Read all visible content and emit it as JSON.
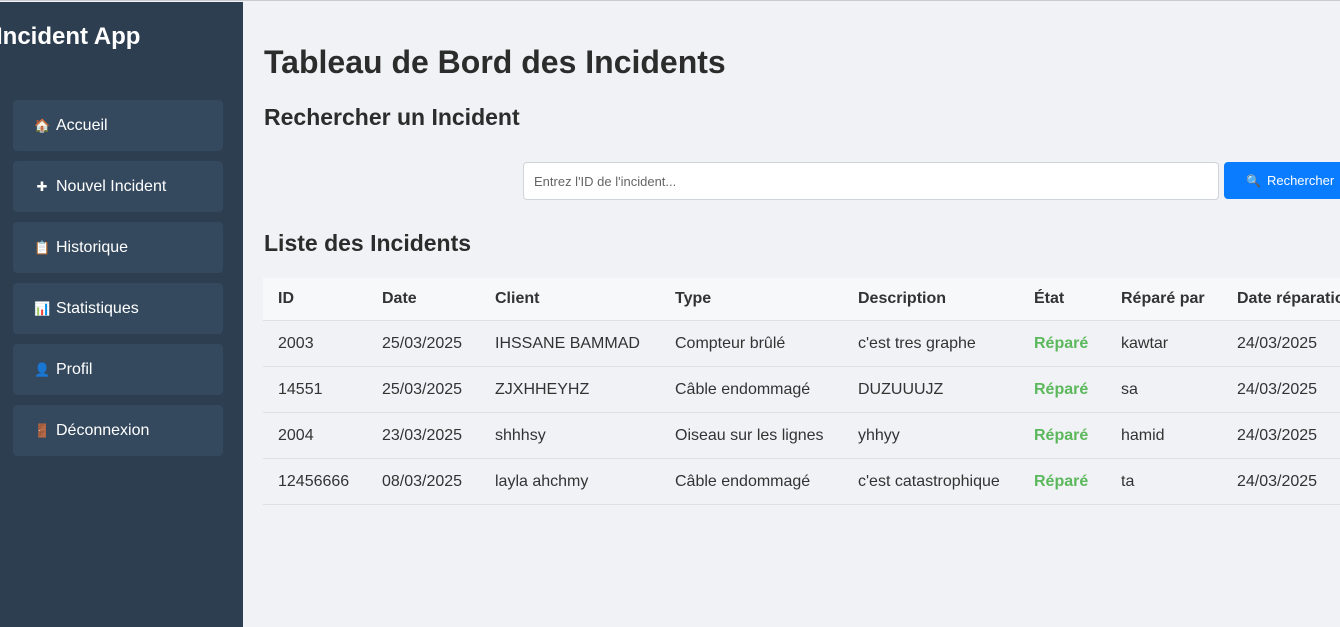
{
  "sidebar": {
    "brand": "Incident App",
    "items": [
      {
        "icon": "🏠",
        "icon_name": "home-icon",
        "label": "Accueil"
      },
      {
        "icon": "✚",
        "icon_name": "plus-icon",
        "label": "Nouvel Incident"
      },
      {
        "icon": "📋",
        "icon_name": "clipboard-icon",
        "label": "Historique"
      },
      {
        "icon": "📊",
        "icon_name": "bar-chart-icon",
        "label": "Statistiques"
      },
      {
        "icon": "👤",
        "icon_name": "user-icon",
        "label": "Profil"
      },
      {
        "icon": "🚪",
        "icon_name": "door-icon",
        "label": "Déconnexion"
      }
    ]
  },
  "main": {
    "title": "Tableau de Bord des Incidents",
    "search_heading": "Rechercher un Incident",
    "search": {
      "placeholder": "Entrez l'ID de l'incident...",
      "value": "",
      "button_icon": "🔍",
      "button_icon_name": "search-icon",
      "button_label": "Rechercher"
    },
    "list_heading": "Liste des Incidents"
  },
  "table": {
    "columns": [
      "ID",
      "Date",
      "Client",
      "Type",
      "Description",
      "État",
      "Réparé par",
      "Date réparation"
    ],
    "rows": [
      [
        "2003",
        "25/03/2025",
        "IHSSANE BAMMAD",
        "Compteur brûlé",
        "c'est tres graphe",
        "Réparé",
        "kawtar",
        "24/03/2025"
      ],
      [
        "14551",
        "25/03/2025",
        "ZJXHHEYHZ",
        "Câble endommagé",
        "DUZUUUJZ",
        "Réparé",
        "sa",
        "24/03/2025"
      ],
      [
        "2004",
        "23/03/2025",
        "shhhsy",
        "Oiseau sur les lignes",
        "yhhyy",
        "Réparé",
        "hamid",
        "24/03/2025"
      ],
      [
        "12456666",
        "08/03/2025",
        "layla ahchmy",
        "Câble endommagé",
        "c'est catastrophique",
        "Réparé",
        "ta",
        "24/03/2025"
      ]
    ]
  },
  "colors": {
    "sidebar_bg": "#2c3e50",
    "nav_item_bg": "#34495e",
    "accent": "#0a7cff",
    "status_repaired": "#5cb85c"
  }
}
